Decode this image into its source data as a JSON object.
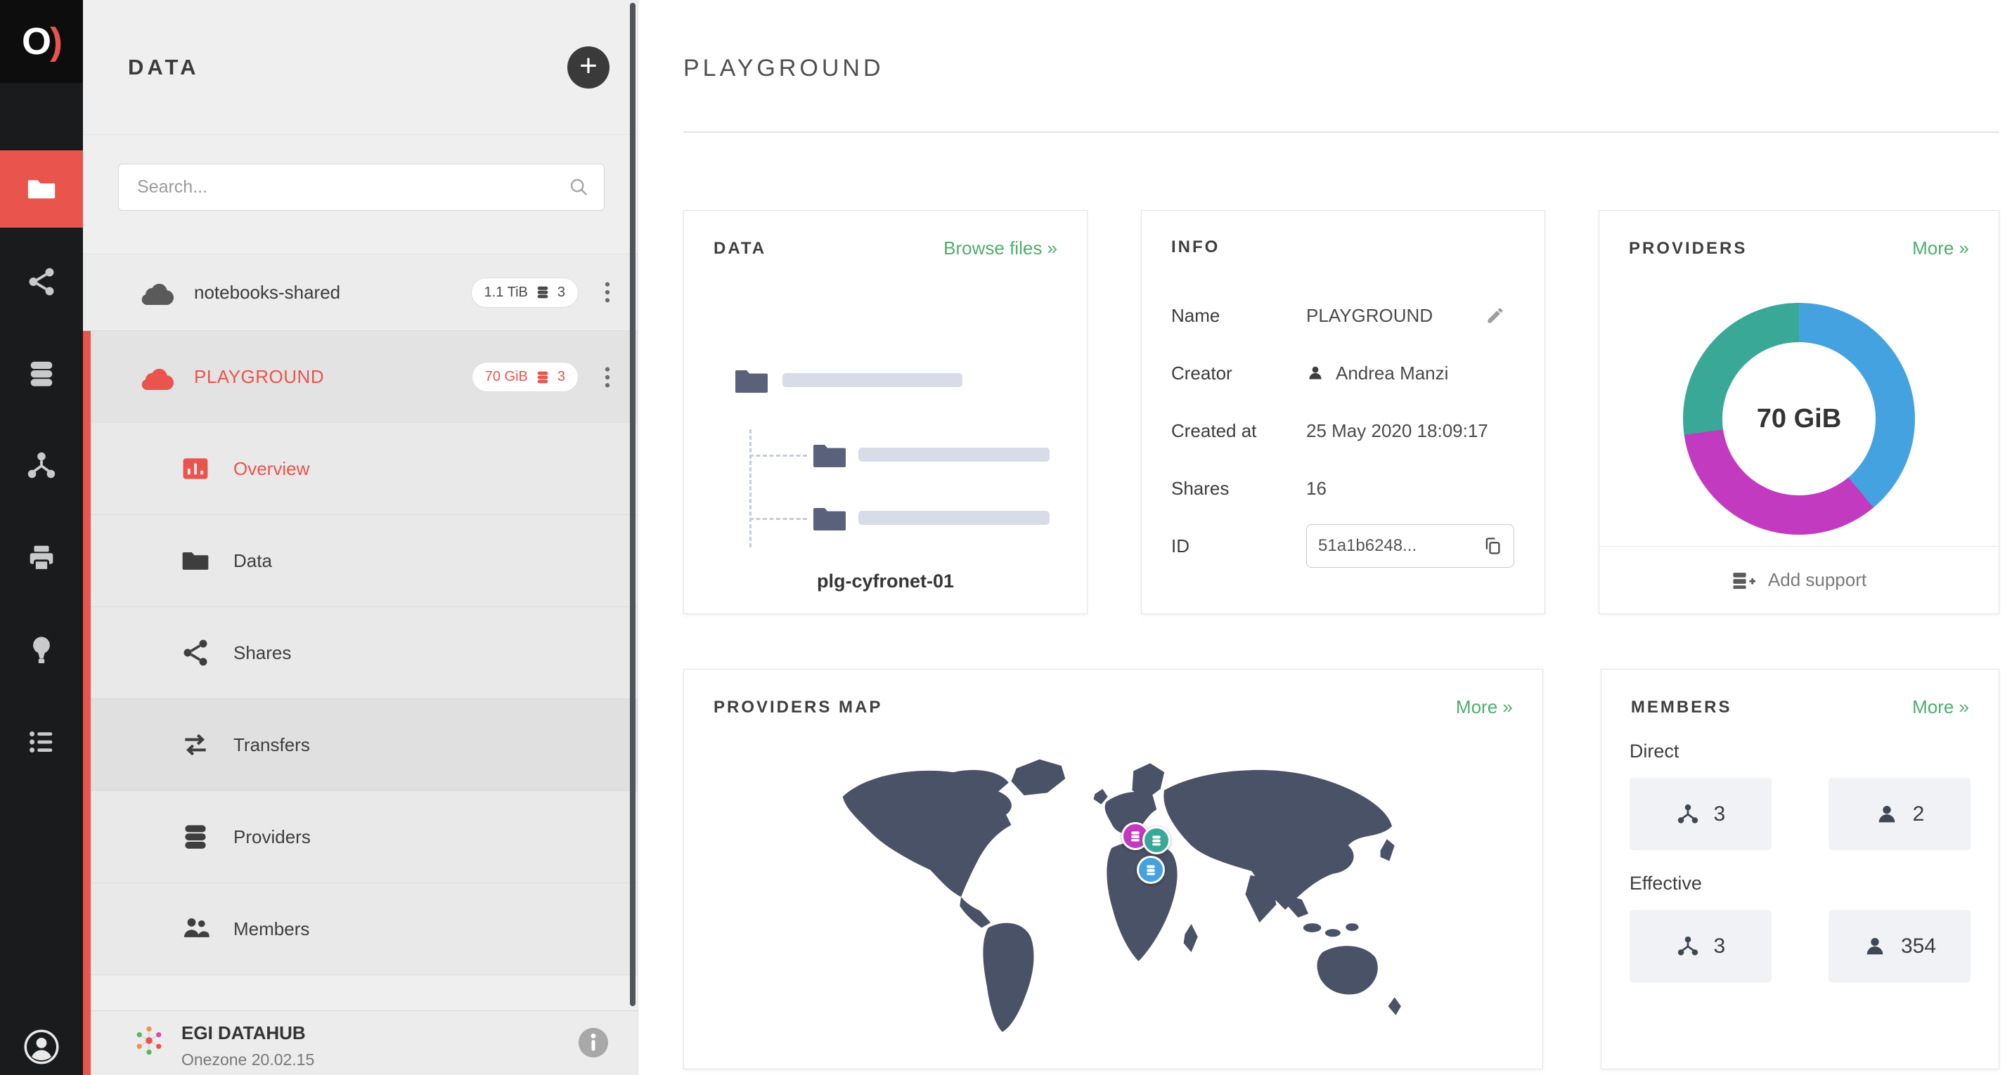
{
  "theme": {
    "accent_red": "#e9544d",
    "link_green": "#4dae6e",
    "map_color": "#4a5267",
    "nav_bg": "#1a1b1c",
    "sidebar_bg": "#efefef"
  },
  "nav": {
    "logo_primary": "O",
    "logo_accent": ")",
    "items": [
      {
        "icon": "folder",
        "active": true
      },
      {
        "icon": "shares"
      },
      {
        "icon": "providers"
      },
      {
        "icon": "groups"
      },
      {
        "icon": "clusters"
      },
      {
        "icon": "harvesters"
      },
      {
        "icon": "tokens"
      }
    ]
  },
  "sidebar": {
    "title": "DATA",
    "add_button": "+",
    "search_placeholder": "Search...",
    "spaces": [
      {
        "name": "notebooks-shared",
        "size": "1.1 TiB",
        "provider_count": "3"
      },
      {
        "name": "PLAYGROUND",
        "size": "70 GiB",
        "provider_count": "3"
      }
    ],
    "space_menu": [
      "Overview",
      "Data",
      "Shares",
      "Transfers",
      "Providers",
      "Members"
    ],
    "footer": {
      "title": "EGI DATAHUB",
      "subtitle": "Onezone 20.02.15"
    }
  },
  "main": {
    "title": "PLAYGROUND",
    "data_card": {
      "title": "DATA",
      "link": "Browse files »",
      "caption": "plg-cyfronet-01"
    },
    "info_card": {
      "title": "INFO",
      "rows": [
        {
          "label": "Name",
          "value": "PLAYGROUND"
        },
        {
          "label": "Creator",
          "value": "Andrea Manzi"
        },
        {
          "label": "Created at",
          "value": "25 May 2020 18:09:17"
        },
        {
          "label": "Shares",
          "value": "16"
        },
        {
          "label": "ID",
          "value": "51a1b6248..."
        }
      ]
    },
    "providers_card": {
      "title": "PROVIDERS",
      "link": "More »",
      "center_label": "70 GiB",
      "footer_label": "Add support",
      "donut": {
        "segments": [
          {
            "color": "#45a2e0",
            "from": 0,
            "to": 140
          },
          {
            "color": "#c23ac0",
            "from": 140,
            "to": 262
          },
          {
            "color": "#3aa896",
            "from": 262,
            "to": 360
          }
        ]
      }
    },
    "map_card": {
      "title": "PROVIDERS MAP",
      "link": "More »"
    },
    "members_card": {
      "title": "MEMBERS",
      "link": "More »",
      "sections": [
        {
          "label": "Direct",
          "groups": "3",
          "users": "2"
        },
        {
          "label": "Effective",
          "groups": "3",
          "users": "354"
        }
      ]
    }
  }
}
